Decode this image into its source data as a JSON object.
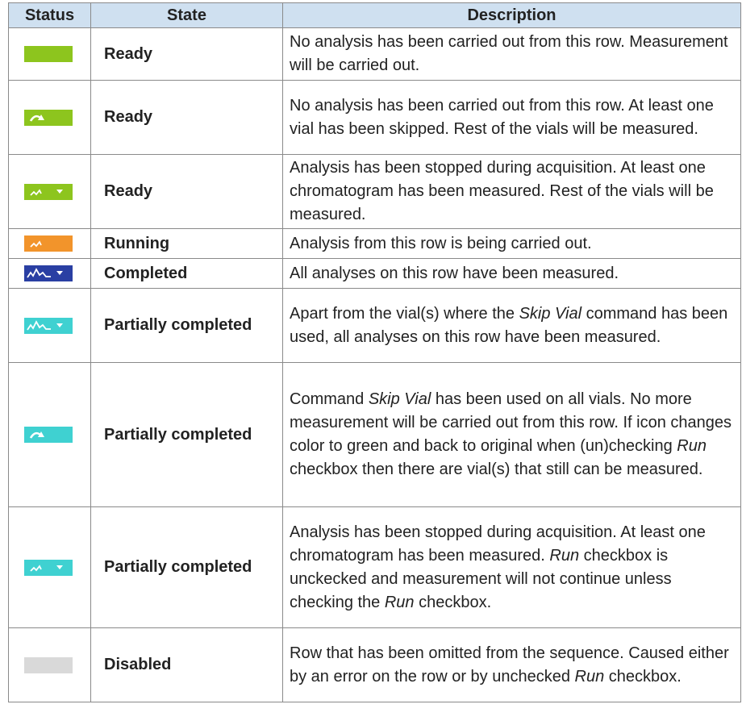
{
  "headers": {
    "status": "Status",
    "state": "State",
    "description": "Description"
  },
  "colors": {
    "header_bg": "#cfe0f0",
    "ready_green": "#8dc51e",
    "running_orange": "#f2942b",
    "completed_blue": "#2a3fa3",
    "partial_cyan": "#3fd1d1",
    "disabled_gray": "#d9d9d9"
  },
  "rows": [
    {
      "icon": "ready-plain",
      "state": "Ready",
      "desc": [
        "No analysis has been carried out from this row. Measurement will be carried out."
      ]
    },
    {
      "icon": "ready-skip-arrow",
      "state": "Ready",
      "desc": [
        "No analysis has been carried out from this row. At least one vial has been skipped. Rest of the vials will be measured."
      ]
    },
    {
      "icon": "ready-stopped-peak-dropdown",
      "state": "Ready",
      "desc": [
        "Analysis has been stopped during acquisition. At least one chromatogram has been measured. Rest of the vials will be measured."
      ]
    },
    {
      "icon": "running-peak",
      "state": "Running",
      "desc": [
        "Analysis from this row is being carried out."
      ]
    },
    {
      "icon": "completed-chromatogram-dropdown",
      "state": "Completed",
      "desc": [
        "All analyses on this row have been measured."
      ]
    },
    {
      "icon": "partial-chromatogram-dropdown",
      "state": "Partially completed",
      "desc": [
        "Apart from the vial(s) where the ",
        "Skip Vial",
        " command has been used, all analyses on this row have been measured."
      ]
    },
    {
      "icon": "partial-skip-arrow",
      "state": "Partially completed",
      "desc": [
        "Command ",
        "Skip Vial",
        " has been used on all vials. No more measurement will be carried out from this row. If icon changes color to green and back to original when (un)checking ",
        "Run",
        " checkbox then there are vial(s) that still can be measured."
      ]
    },
    {
      "icon": "partial-stopped-peak-dropdown",
      "state": "Partially completed",
      "desc": [
        "Analysis has been stopped during acquisition. At least one chromatogram has been measured. ",
        "Run",
        " checkbox is unckecked and measurement will not continue unless checking the ",
        "Run",
        " checkbox."
      ]
    },
    {
      "icon": "disabled-plain",
      "state": "Disabled",
      "desc": [
        "Row that has been omitted from the sequence. Caused either by an error on the row or by unchecked ",
        "Run",
        " checkbox."
      ]
    }
  ]
}
